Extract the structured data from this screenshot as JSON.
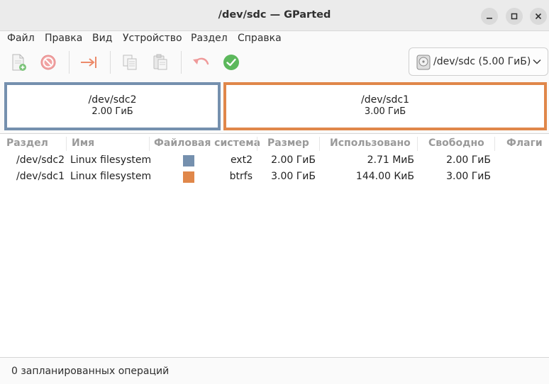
{
  "window": {
    "title": "/dev/sdc — GParted"
  },
  "menu": [
    "Файл",
    "Правка",
    "Вид",
    "Устройство",
    "Раздел",
    "Справка"
  ],
  "toolbar": {
    "icons": [
      "new-partition-icon",
      "delete-partition-icon",
      "resize-move-icon",
      "copy-icon",
      "paste-icon",
      "undo-icon",
      "apply-icon"
    ]
  },
  "device_selector": {
    "label": "/dev/sdc  (5.00 ГиБ)"
  },
  "graph": {
    "partitions": [
      {
        "name": "/dev/sdc2",
        "size": "2.00 ГиБ",
        "color": "#7590ae"
      },
      {
        "name": "/dev/sdc1",
        "size": "3.00 ГиБ",
        "color": "#e0874a"
      }
    ]
  },
  "table": {
    "headers": [
      "Раздел",
      "Имя",
      "Файловая система",
      "Размер",
      "Использовано",
      "Свободно",
      "Флаги"
    ],
    "rows": [
      {
        "partition": "/dev/sdc2",
        "name": "Linux filesystem",
        "fs_color": "#7590ae",
        "fs": "ext2",
        "size": "2.00 ГиБ",
        "used": "2.71 МиБ",
        "free": "2.00 ГиБ",
        "flags": ""
      },
      {
        "partition": "/dev/sdc1",
        "name": "Linux filesystem",
        "fs_color": "#e0874a",
        "fs": "btrfs",
        "size": "3.00 ГиБ",
        "used": "144.00 КиБ",
        "free": "3.00 ГиБ",
        "flags": ""
      }
    ]
  },
  "status": {
    "text": "0 запланированных операций"
  }
}
